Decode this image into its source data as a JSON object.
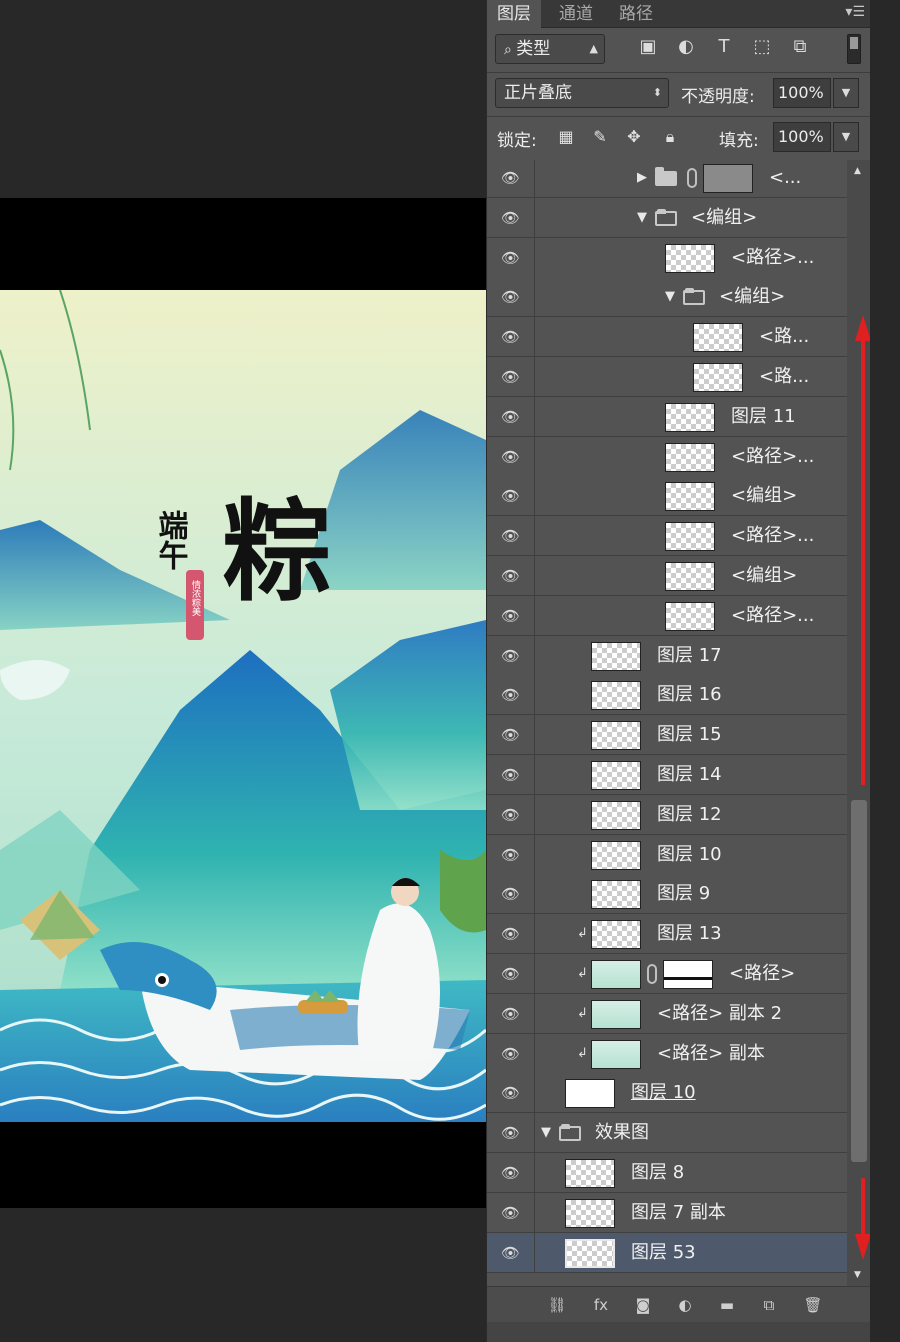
{
  "panel": {
    "tabs": [
      "图层",
      "通道",
      "路径"
    ],
    "menu_icon": "menu-icon",
    "filter_kind": "类型",
    "blend_mode": "正片叠底",
    "opacity_label": "不透明度:",
    "opacity_value": "100%",
    "lock_label": "锁定:",
    "fill_label": "填充:",
    "fill_value": "100%"
  },
  "layers": [
    {
      "name": "<...",
      "depth": 4,
      "type": "group-collapsed",
      "thumb": "grey",
      "link": true
    },
    {
      "name": "<编组>",
      "depth": 4,
      "type": "group-open"
    },
    {
      "name": "<路径>...",
      "depth": 5,
      "type": "layer"
    },
    {
      "name": "<编组>",
      "depth": 5,
      "type": "group-open"
    },
    {
      "name": "<路...",
      "depth": 6,
      "type": "layer"
    },
    {
      "name": "<路...",
      "depth": 6,
      "type": "layer"
    },
    {
      "name": "图层 11",
      "depth": 5,
      "type": "layer"
    },
    {
      "name": "<路径>...",
      "depth": 5,
      "type": "layer"
    },
    {
      "name": "<编组>",
      "depth": 5,
      "type": "layer"
    },
    {
      "name": "<路径>...",
      "depth": 5,
      "type": "layer"
    },
    {
      "name": "<编组>",
      "depth": 5,
      "type": "layer"
    },
    {
      "name": "<路径>...",
      "depth": 5,
      "type": "layer"
    },
    {
      "name": "图层 17",
      "depth": 2,
      "type": "layer"
    },
    {
      "name": "图层 16",
      "depth": 2,
      "type": "layer"
    },
    {
      "name": "图层 15",
      "depth": 2,
      "type": "layer"
    },
    {
      "name": "图层 14",
      "depth": 2,
      "type": "layer"
    },
    {
      "name": "图层 12",
      "depth": 2,
      "type": "layer"
    },
    {
      "name": "图层 10",
      "depth": 2,
      "type": "layer"
    },
    {
      "name": "图层 9",
      "depth": 2,
      "type": "layer"
    },
    {
      "name": "图层 13",
      "depth": 2,
      "type": "layer",
      "clip": true
    },
    {
      "name": "<路径>",
      "depth": 2,
      "type": "layer",
      "clip": true,
      "thumb": "teal",
      "link": true,
      "mask": true
    },
    {
      "name": "<路径> 副本 2",
      "depth": 2,
      "type": "layer",
      "clip": true,
      "thumb": "teal"
    },
    {
      "name": "<路径> 副本",
      "depth": 2,
      "type": "layer",
      "clip": true,
      "thumb": "teal"
    },
    {
      "name": "图层 10",
      "depth": 1,
      "type": "layer",
      "thumb": "white",
      "underline": true
    },
    {
      "name": "效果图",
      "depth": 0,
      "type": "group-open"
    },
    {
      "name": "图层 8",
      "depth": 1,
      "type": "layer"
    },
    {
      "name": "图层 7 副本",
      "depth": 1,
      "type": "layer"
    },
    {
      "name": "图层 53",
      "depth": 1,
      "type": "layer",
      "selected": true
    }
  ],
  "artwork": {
    "title_small": "端午",
    "title_big": "粽",
    "seal_text": "情浓粽美"
  },
  "colors": {
    "panel_bg": "#535353",
    "selected_row": "#4e5a6b",
    "red_arrow": "#e02020"
  }
}
